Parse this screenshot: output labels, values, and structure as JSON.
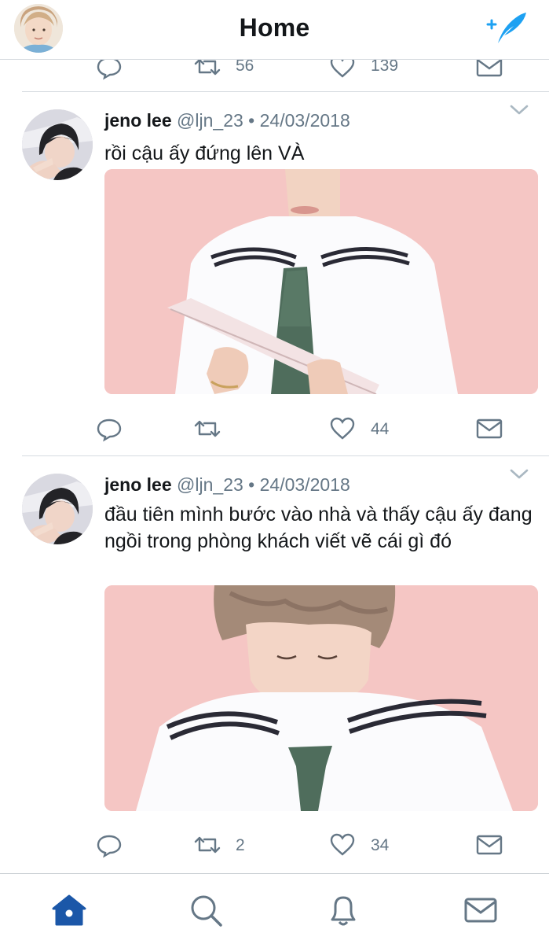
{
  "header": {
    "title": "Home",
    "profile_avatar": "profile-avatar-photo",
    "compose_icon": "compose-tweet-icon"
  },
  "previous_tweet": {
    "retweet_count": "56",
    "like_count": "139"
  },
  "tweets": [
    {
      "name": "jeno lee",
      "handle": "@ljn_23",
      "separator": "•",
      "date": "24/03/2018",
      "text": "rồi cậu ấy đứng lên VÀ",
      "media": "photo-boy-sailor-collar-holding-tablet",
      "reply_count": "",
      "retweet_count": "",
      "like_count": "44"
    },
    {
      "name": "jeno lee",
      "handle": "@ljn_23",
      "separator": "•",
      "date": "24/03/2018",
      "text": "đầu tiên mình bước vào nhà và thấy cậu ấy đang ngồi trong phòng khách viết vẽ cái gì đó",
      "media": "photo-boy-sailor-collar-looking-down",
      "reply_count": "",
      "retweet_count": "2",
      "like_count": "34"
    }
  ],
  "tabbar": {
    "items": [
      "home-icon",
      "search-icon",
      "notifications-icon",
      "messages-icon"
    ],
    "active": "home-icon"
  },
  "colors": {
    "accent": "#1da1f2",
    "active_tab": "#1b57a8",
    "icon_gray": "#657786",
    "text": "#14171a",
    "media_bg": "#f5c9c7"
  }
}
